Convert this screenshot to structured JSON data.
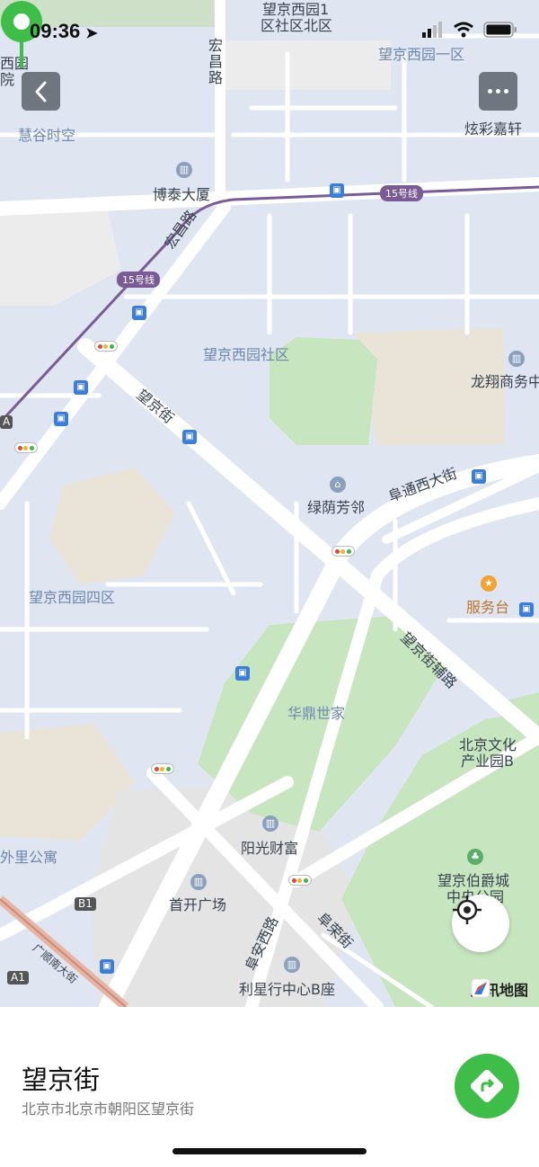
{
  "status": {
    "time": "09:36"
  },
  "map": {
    "labels": {
      "xiyuan1": "望京西园1",
      "xiyuan1b": "区社区北区",
      "hongchang": "宏昌路",
      "xiyuanyiqu": "望京西园一区",
      "xiyuan_left": "西园",
      "yuan_left": "院",
      "huigu": "慧谷时空",
      "xuancai": "炫彩嘉轩",
      "botai": "博泰大厦",
      "line15a": "15号线",
      "line15b": "15号线",
      "hongchang2": "宏昌路",
      "xiyuanshequ": "望京西园社区",
      "longxiang": "龙翔商务中",
      "wangjingjie_road": "望京街",
      "lvyin": "绿荫芳邻",
      "futong": "阜通西大街",
      "fuwutai": "服务台",
      "xiyuansiqu": "望京西园四区",
      "fulu": "望京街辅路",
      "huading": "华鼎世家",
      "beijingwenhua1": "北京文化",
      "beijingwenhua2": "产业园B",
      "yangguang": "阳光财富",
      "waili": "外里公寓",
      "shoukai": "首开广场",
      "bojue1": "望京伯爵城",
      "bojue2": "中央公园",
      "fuan": "阜安西路",
      "furong": "阜荣街",
      "guangshun": "广顺南大街",
      "lixing": "利星行中心B座",
      "b1": "B1",
      "a1": "A1",
      "a_edge": "A"
    },
    "logo_text": "腾讯地图"
  },
  "place": {
    "title": "望京街",
    "address": "北京市北京市朝阳区望京街"
  },
  "icons": {
    "back": "back-chevron-icon",
    "more": "more-dots-icon",
    "locate": "crosshair-locate-icon",
    "navigate": "navigation-arrow-icon",
    "pin": "location-pin-icon"
  },
  "colors": {
    "accent": "#3fbd49",
    "pin": "#3fbd49",
    "metro": "#7a5b96"
  }
}
